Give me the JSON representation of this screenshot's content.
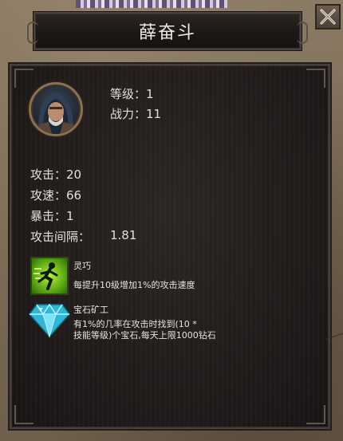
{
  "window": {
    "title": "薛奋斗",
    "close_icon": "close-x-icon"
  },
  "hero": {
    "avatar_icon": "hooded-warrior-portrait",
    "level_label": "等级：",
    "level_value": "1",
    "power_label": "战力：",
    "power_value": "11"
  },
  "stats": [
    {
      "label": "攻击：",
      "value": "20"
    },
    {
      "label": "攻速：",
      "value": "66"
    },
    {
      "label": "暴击：",
      "value": "1"
    },
    {
      "label": "攻击间隔：",
      "value": "1.81"
    }
  ],
  "skills": [
    {
      "icon": "running-figure-icon",
      "name": "灵巧",
      "desc_lines": [
        "每提升10级增加1%的攻击速度"
      ]
    },
    {
      "icon": "diamond-gem-icon",
      "name": "宝石矿工",
      "desc_lines": [
        "有1%的几率在攻击时找到(10 *",
        "技能等级)个宝石,每天上限1000钻石"
      ]
    }
  ],
  "colors": {
    "panel": "#211c1b",
    "frame": "#47403a",
    "text": "#e4dfd6",
    "skill1_green": "#7ec81e",
    "skill2_cyan": "#35c6e0"
  }
}
